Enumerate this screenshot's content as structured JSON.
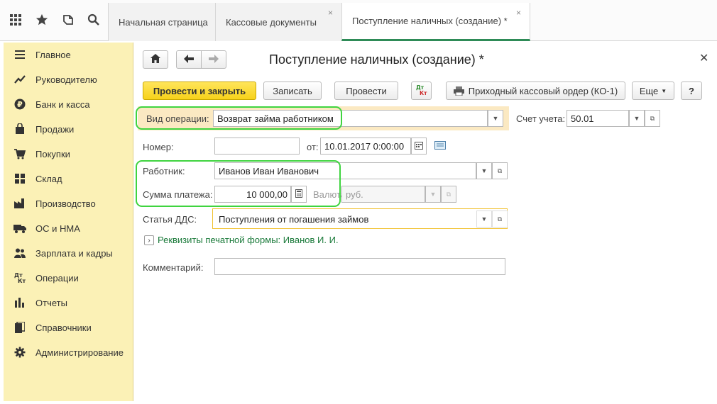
{
  "tabs": {
    "home": "Начальная страница",
    "cash_docs": "Кассовые документы",
    "receipt": "Поступление наличных (создание) *"
  },
  "sidebar": {
    "items": [
      {
        "label": "Главное",
        "icon": "menu-icon"
      },
      {
        "label": "Руководителю",
        "icon": "trend-icon"
      },
      {
        "label": "Банк и касса",
        "icon": "ruble-icon"
      },
      {
        "label": "Продажи",
        "icon": "bag-icon"
      },
      {
        "label": "Покупки",
        "icon": "cart-icon"
      },
      {
        "label": "Склад",
        "icon": "warehouse-icon"
      },
      {
        "label": "Производство",
        "icon": "factory-icon"
      },
      {
        "label": "ОС и НМА",
        "icon": "truck-icon"
      },
      {
        "label": "Зарплата и кадры",
        "icon": "people-icon"
      },
      {
        "label": "Операции",
        "icon": "dt-kt-icon"
      },
      {
        "label": "Отчеты",
        "icon": "bar-chart-icon"
      },
      {
        "label": "Справочники",
        "icon": "book-icon"
      },
      {
        "label": "Администрирование",
        "icon": "gear-icon"
      }
    ]
  },
  "form": {
    "title": "Поступление наличных (создание) *",
    "toolbar": {
      "post_close": "Провести и закрыть",
      "save": "Записать",
      "post": "Провести",
      "dt_kt": "Дт Кт",
      "print_order": "Приходный кассовый ордер (КО-1)",
      "more": "Еще",
      "help": "?"
    },
    "operation_type": {
      "label": "Вид операции:",
      "value": "Возврат займа работником"
    },
    "account": {
      "label": "Счет учета:",
      "value": "50.01"
    },
    "number": {
      "label": "Номер:",
      "value": ""
    },
    "date": {
      "label": "от:",
      "value": "10.01.2017  0:00:00"
    },
    "employee": {
      "label": "Работник:",
      "value": "Иванов Иван Иванович"
    },
    "amount": {
      "label": "Сумма платежа:",
      "value": "10 000,00"
    },
    "currency": {
      "label": "Валюта:",
      "value": "руб."
    },
    "dds": {
      "label": "Статья ДДС:",
      "value": "Поступления от погашения займов"
    },
    "print_details_link": "Реквизиты печатной формы: Иванов И. И.",
    "comment": {
      "label": "Комментарий:",
      "value": ""
    }
  },
  "colors": {
    "sidebar_bg": "#fbf1b6",
    "primary_button": "#f7d21a",
    "highlight_green": "#3fd43f",
    "active_field_border": "#f1c232",
    "link": "#1a7a3a"
  }
}
